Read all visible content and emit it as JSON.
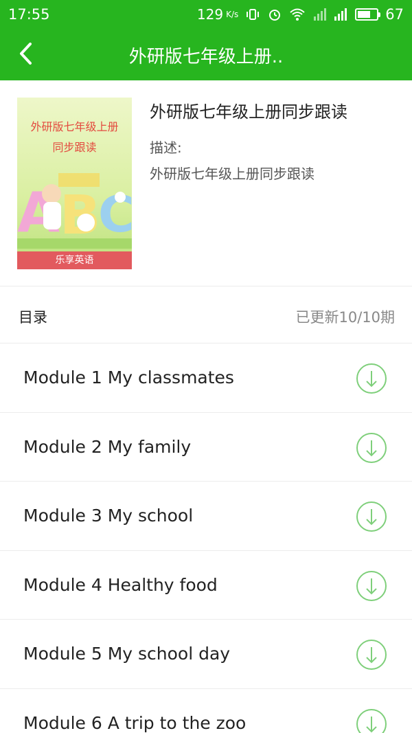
{
  "status": {
    "time": "17:55",
    "net_speed": "129",
    "net_unit": "K/s",
    "battery": "67"
  },
  "header": {
    "title": "外研版七年级上册.."
  },
  "book": {
    "cover_title_line1": "外研版七年级上册",
    "cover_title_line2": "同步跟读",
    "cover_footer": "乐享英语",
    "title": "外研版七年级上册同步跟读",
    "desc_label": "描述:",
    "desc_text": "外研版七年级上册同步跟读"
  },
  "catalog": {
    "label": "目录",
    "status": "已更新10/10期"
  },
  "modules": [
    {
      "label": "Module 1 My classmates"
    },
    {
      "label": "Module 2 My family"
    },
    {
      "label": "Module 3 My school"
    },
    {
      "label": "Module 4 Healthy food"
    },
    {
      "label": "Module 5 My school day"
    },
    {
      "label": "Module 6 A trip to the zoo"
    }
  ],
  "colors": {
    "brand": "#27b51f",
    "download_icon": "#7ecf7a"
  },
  "icons": {
    "back": "chevron-left-icon",
    "download": "download-circle-icon"
  }
}
